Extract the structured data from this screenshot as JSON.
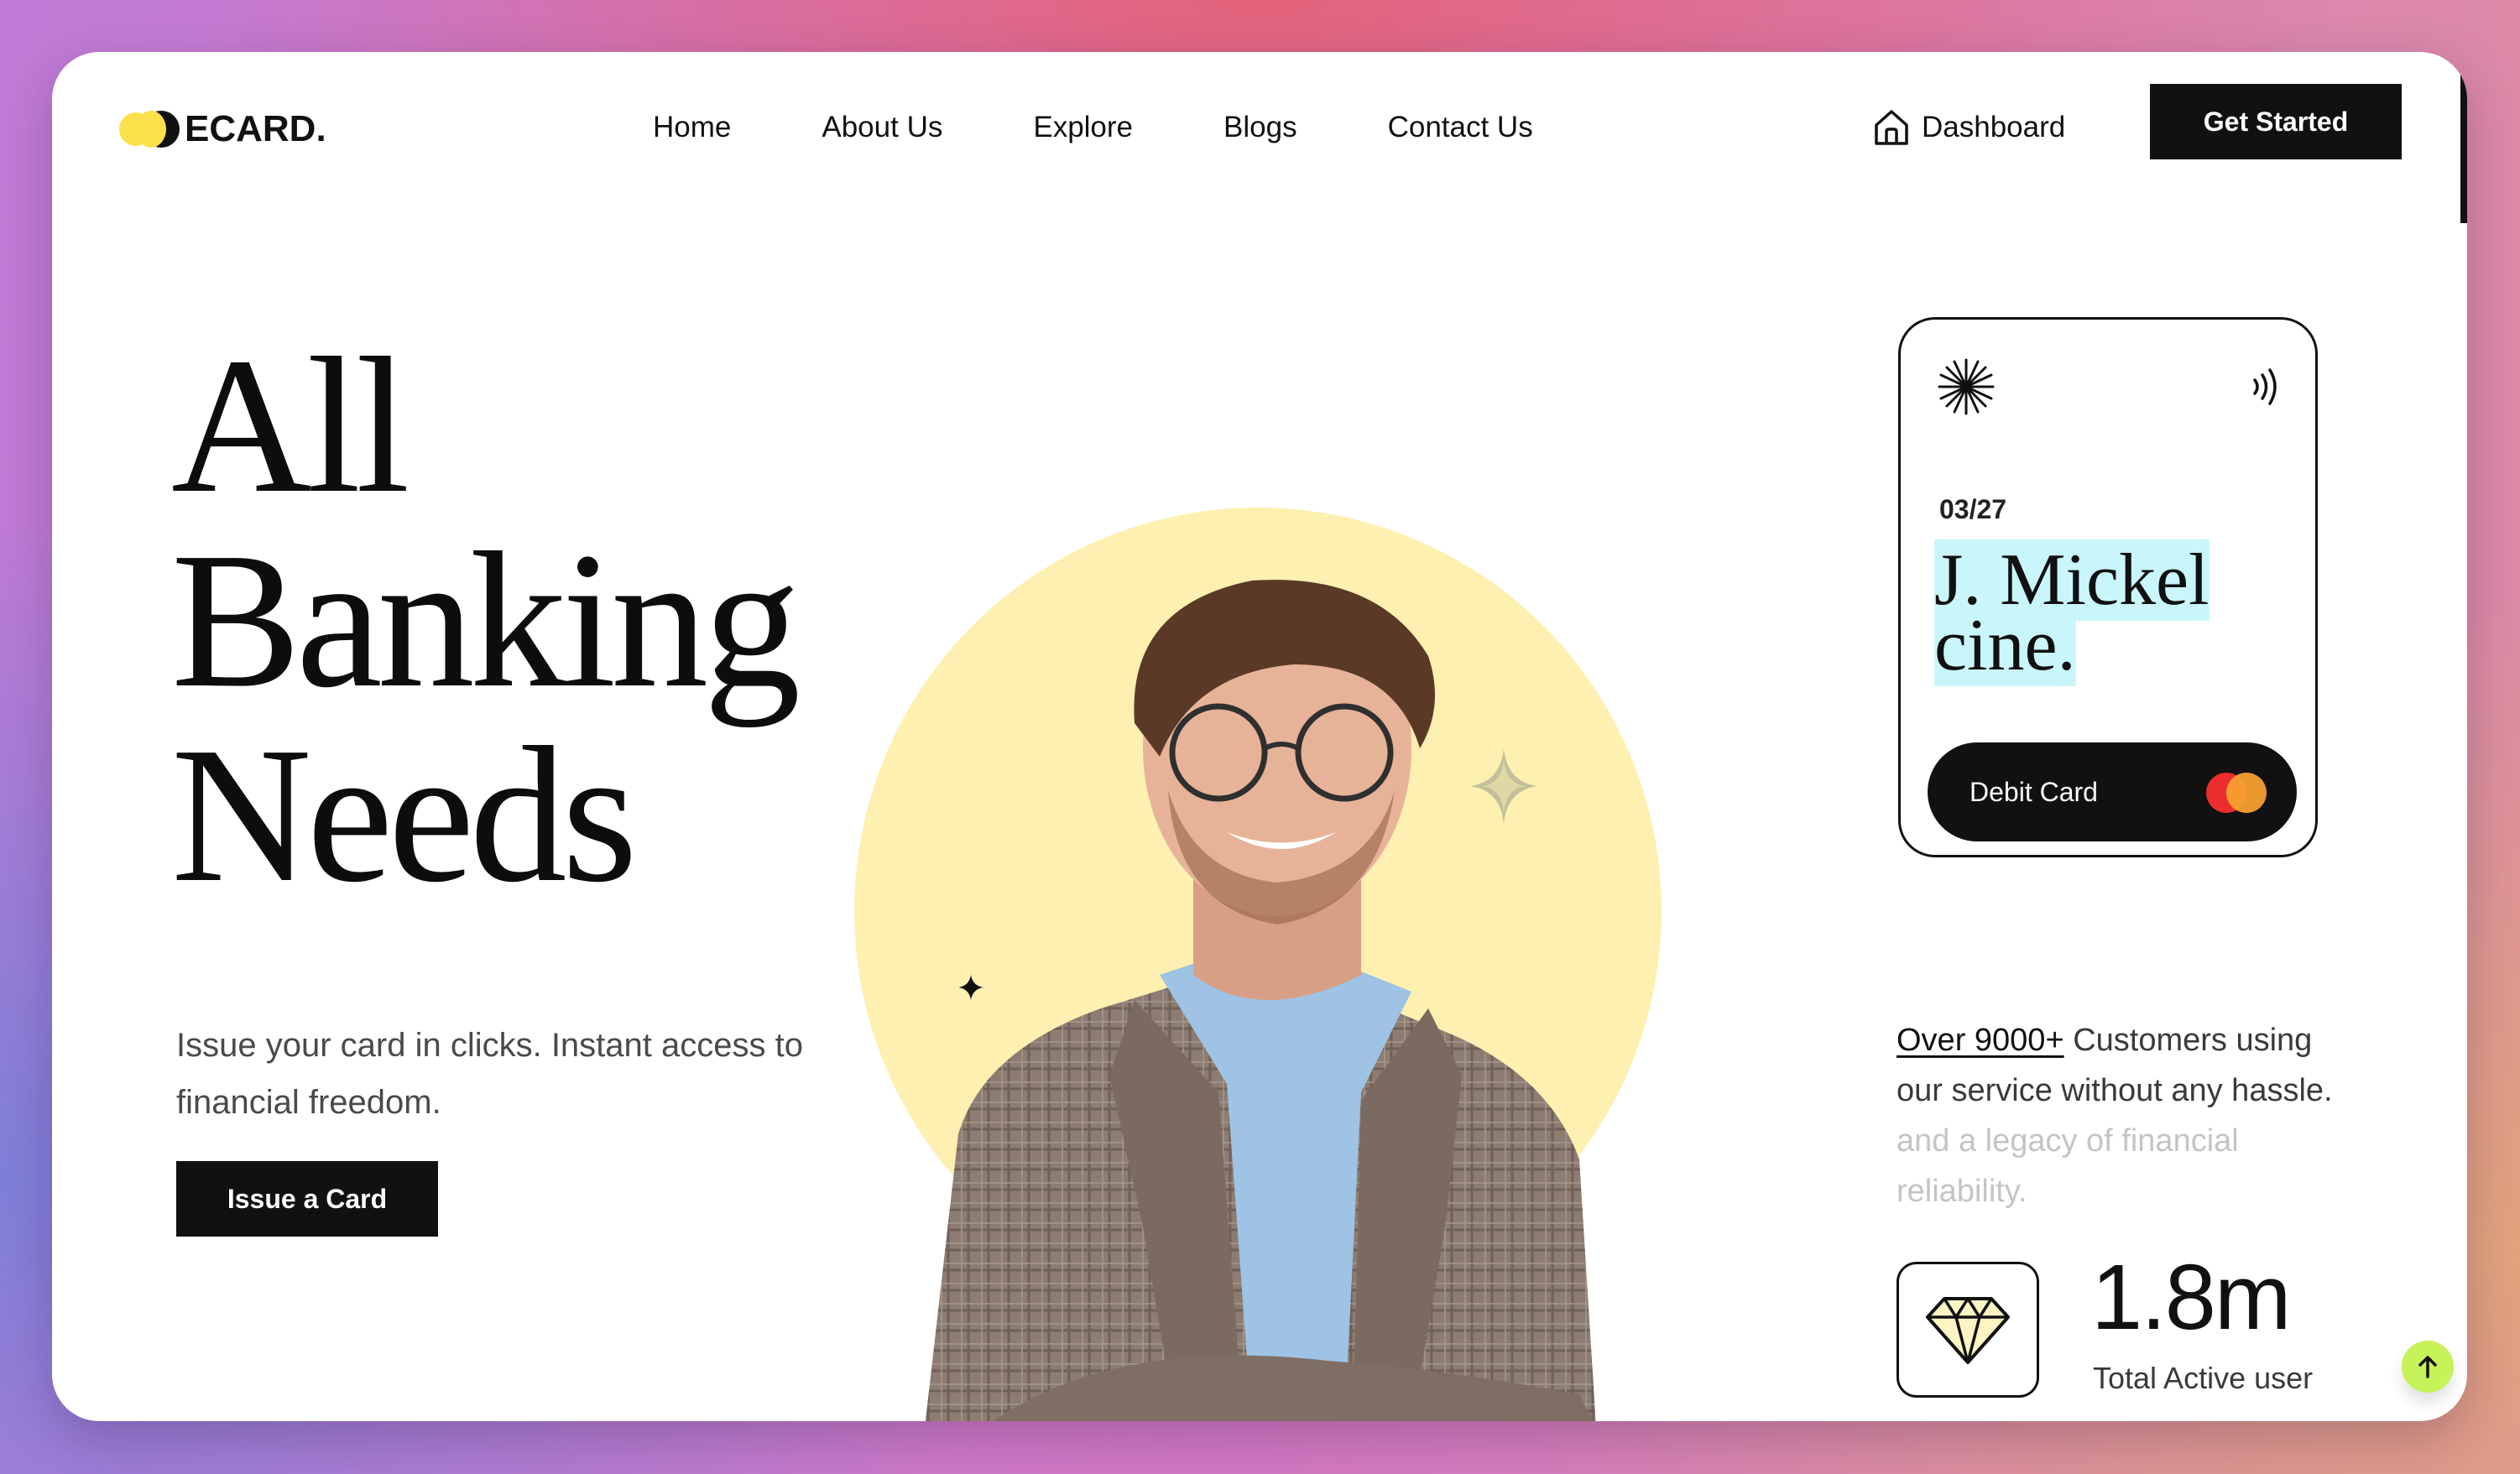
{
  "brand": {
    "name": "ECARD."
  },
  "nav": {
    "items": [
      "Home",
      "About Us",
      "Explore",
      "Blogs",
      "Contact Us"
    ]
  },
  "header": {
    "dashboard_label": "Dashboard",
    "cta_label": "Get Started"
  },
  "hero": {
    "headline": [
      "All",
      "Banking",
      "Needs"
    ],
    "subtitle": "Issue your card in clicks. Instant access to financial freedom.",
    "button_label": "Issue a Card"
  },
  "card": {
    "expiry": "03/27",
    "holder_line1": "J. Mickel",
    "holder_line2": "cine.",
    "type_label": "Debit Card"
  },
  "stats": {
    "customers_highlight": "Over 9000+",
    "customers_text": " Customers using our service without any hassle.",
    "customers_muted": " and a legacy of financial reliability.",
    "active_users_value": "1.8m",
    "active_users_label": "Total Active user"
  },
  "colors": {
    "accent_yellow": "#fdf0b0",
    "logo_yellow": "#fbe24c",
    "highlight_cyan": "#c9f6fb",
    "scroll_button_green": "#c6f25a",
    "primary_dark": "#111111"
  },
  "icons": {
    "dashboard": "home-icon",
    "card_logo": "starburst-icon",
    "contactless": "nfc-icon",
    "network": "mastercard-icon",
    "stat": "diamond-icon",
    "scroll": "arrow-up-icon"
  }
}
